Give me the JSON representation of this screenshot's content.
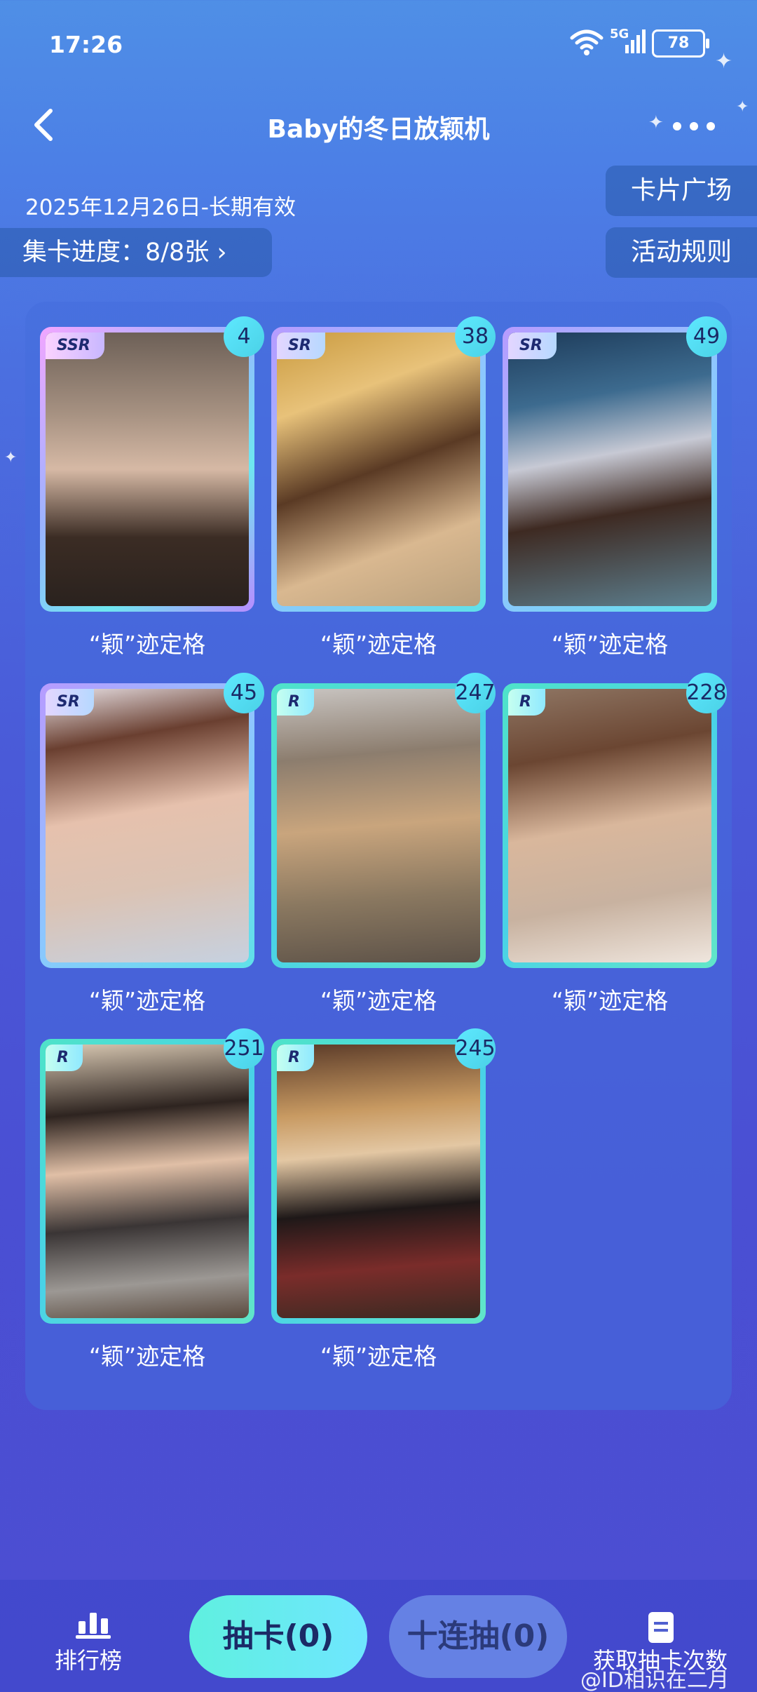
{
  "status_bar": {
    "time": "17:26",
    "network": "5G",
    "battery": "78"
  },
  "nav": {
    "title": "Baby的冬日放颖机"
  },
  "header": {
    "date_range": "2025年12月26日-长期有效",
    "progress": "集卡进度：8/8张 ›",
    "card_square_btn": "卡片广场",
    "rules_btn": "活动规则"
  },
  "cards": [
    {
      "rarity": "SSR",
      "count": "4",
      "caption": "“颖”迹定格"
    },
    {
      "rarity": "SR",
      "count": "38",
      "caption": "“颖”迹定格"
    },
    {
      "rarity": "SR",
      "count": "49",
      "caption": "“颖”迹定格"
    },
    {
      "rarity": "SR",
      "count": "45",
      "caption": "“颖”迹定格"
    },
    {
      "rarity": "R",
      "count": "247",
      "caption": "“颖”迹定格"
    },
    {
      "rarity": "R",
      "count": "228",
      "caption": "“颖”迹定格"
    },
    {
      "rarity": "R",
      "count": "251",
      "caption": "“颖”迹定格"
    },
    {
      "rarity": "R",
      "count": "245",
      "caption": "“颖”迹定格"
    }
  ],
  "bottom": {
    "ranking_label": "排行榜",
    "draw_one": "抽卡(0)",
    "draw_ten": "十连抽(0)",
    "get_chances": "获取抽卡次数"
  },
  "watermark": "@ID相识在二月"
}
